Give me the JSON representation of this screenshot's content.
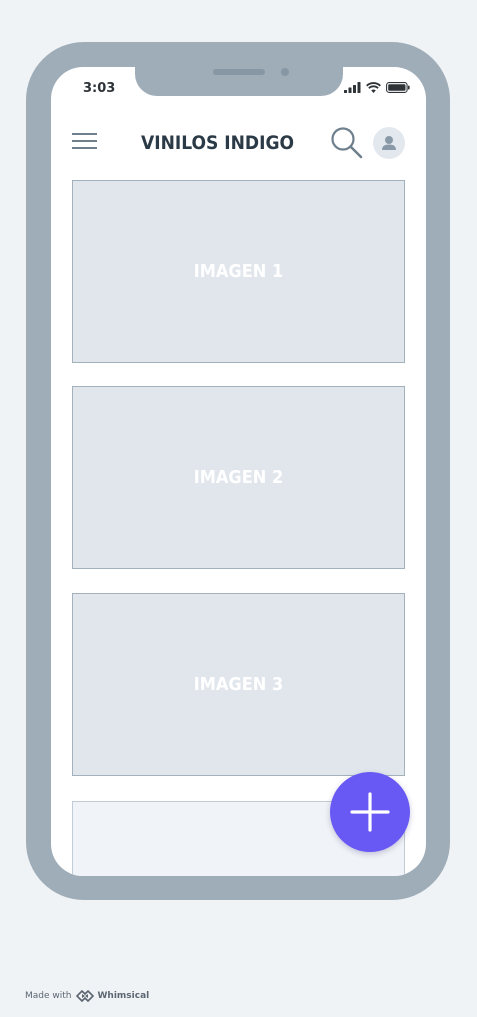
{
  "status_bar": {
    "time": "3:03"
  },
  "header": {
    "title": "VINILOS INDIGO",
    "menu_icon": "hamburger-menu-icon",
    "search_icon": "search-icon",
    "avatar_icon": "user-avatar-icon"
  },
  "cards": [
    {
      "label": "IMAGEN 1"
    },
    {
      "label": "IMAGEN 2"
    },
    {
      "label": "IMAGEN 3"
    },
    {
      "label": ""
    }
  ],
  "fab": {
    "icon": "plus-icon",
    "color": "#6858f4"
  },
  "footer": {
    "prefix": "Made with",
    "brand": "Whimsical"
  },
  "colors": {
    "phone_frame": "#9fadb9",
    "page_background": "#f0f3f6",
    "card_fill": "#e1e6ed",
    "title_text": "#2b3a47"
  }
}
